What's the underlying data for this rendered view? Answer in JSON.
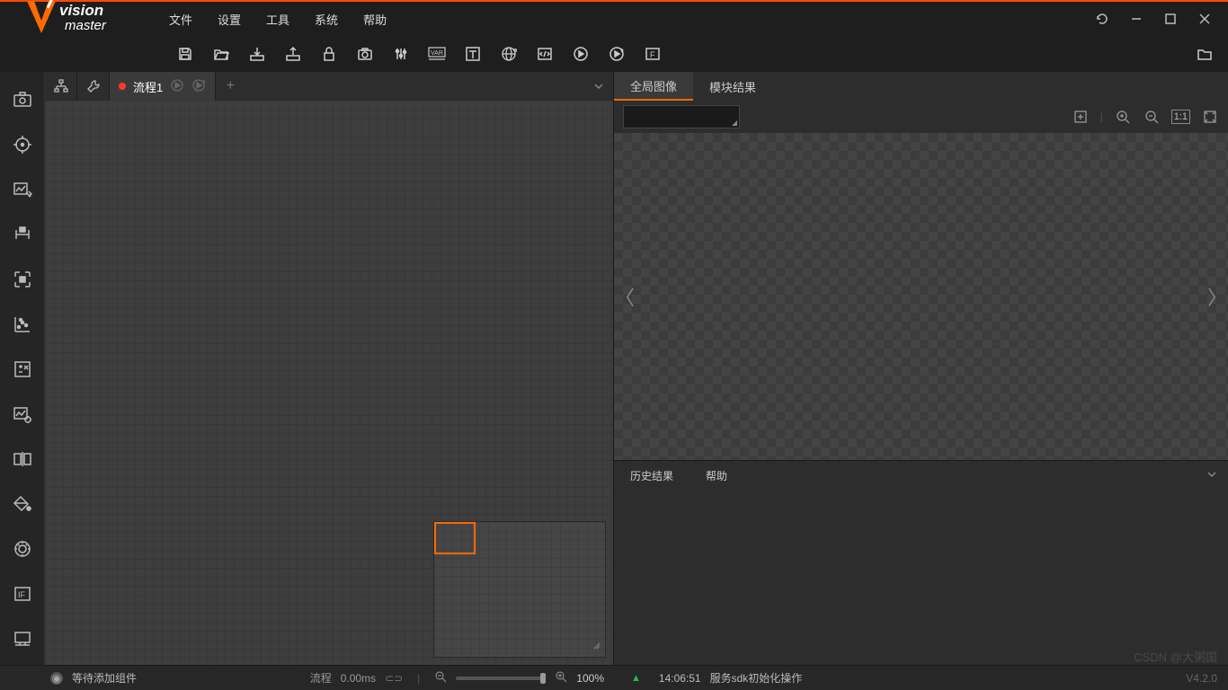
{
  "app": {
    "name_top": "vision",
    "name_bottom": "master"
  },
  "menu": {
    "file": "文件",
    "settings": "设置",
    "tools": "工具",
    "system": "系统",
    "help": "帮助"
  },
  "flow": {
    "tab1": "流程1",
    "timing_label": "流程",
    "timing_value": "0.00ms",
    "zoom": "100%"
  },
  "right": {
    "tab_global": "全局图像",
    "tab_module": "模块结果",
    "btab_history": "历史结果",
    "btab_help": "帮助",
    "one_to_one": "1:1"
  },
  "status": {
    "wait_add": "等待添加组件",
    "time": "14:06:51",
    "message": "服务sdk初始化操作",
    "version": "V4.2.0"
  },
  "watermark": "CSDN @大粥国"
}
